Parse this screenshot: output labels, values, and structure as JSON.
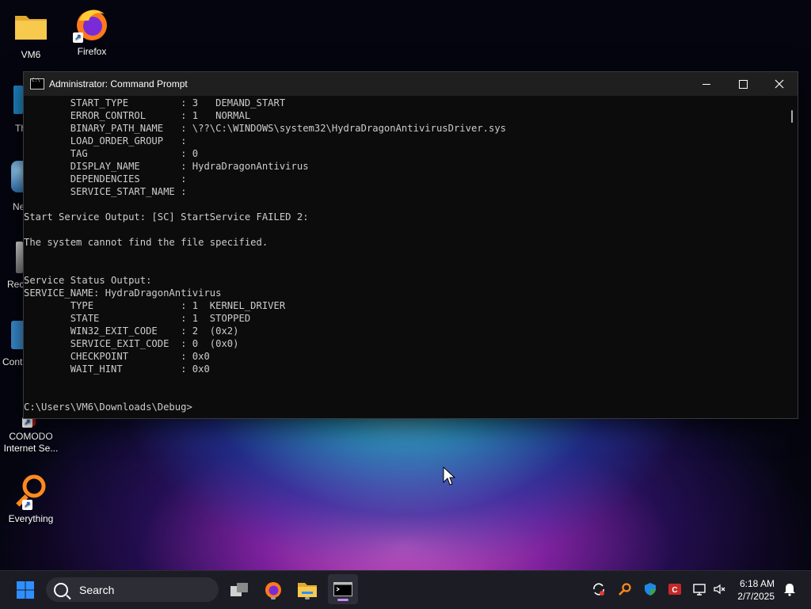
{
  "desktop": {
    "icons": [
      {
        "label": "VM6",
        "icon": "folder-icon"
      },
      {
        "label": "Firefox",
        "icon": "firefox-icon"
      },
      {
        "label": "COMODO Internet Se...",
        "icon": "comodo-icon"
      },
      {
        "label": "Everything",
        "icon": "everything-search-icon"
      }
    ],
    "partial_labels": [
      "Th",
      "Ne",
      "Rec",
      "Cont"
    ]
  },
  "window": {
    "title": "Administrator: Command Prompt",
    "console_text": "        START_TYPE         : 3   DEMAND_START\n        ERROR_CONTROL      : 1   NORMAL\n        BINARY_PATH_NAME   : \\??\\C:\\WINDOWS\\system32\\HydraDragonAntivirusDriver.sys\n        LOAD_ORDER_GROUP   :\n        TAG                : 0\n        DISPLAY_NAME       : HydraDragonAntivirus\n        DEPENDENCIES       :\n        SERVICE_START_NAME :\n\nStart Service Output: [SC] StartService FAILED 2:\n\nThe system cannot find the file specified.\n\n\nService Status Output:\nSERVICE_NAME: HydraDragonAntivirus\n        TYPE               : 1  KERNEL_DRIVER\n        STATE              : 1  STOPPED\n        WIN32_EXIT_CODE    : 2  (0x2)\n        SERVICE_EXIT_CODE  : 0  (0x0)\n        CHECKPOINT         : 0x0\n        WAIT_HINT          : 0x0\n\n\nC:\\Users\\VM6\\Downloads\\Debug>"
  },
  "taskbar": {
    "search_label": "Search",
    "time": "6:18 AM",
    "date": "2/7/2025"
  },
  "colors": {
    "console_bg": "#0c0c0c",
    "console_text": "#cccccc",
    "taskbar_bg": "#1c1c24",
    "windows_blue": "#2f8fff"
  }
}
